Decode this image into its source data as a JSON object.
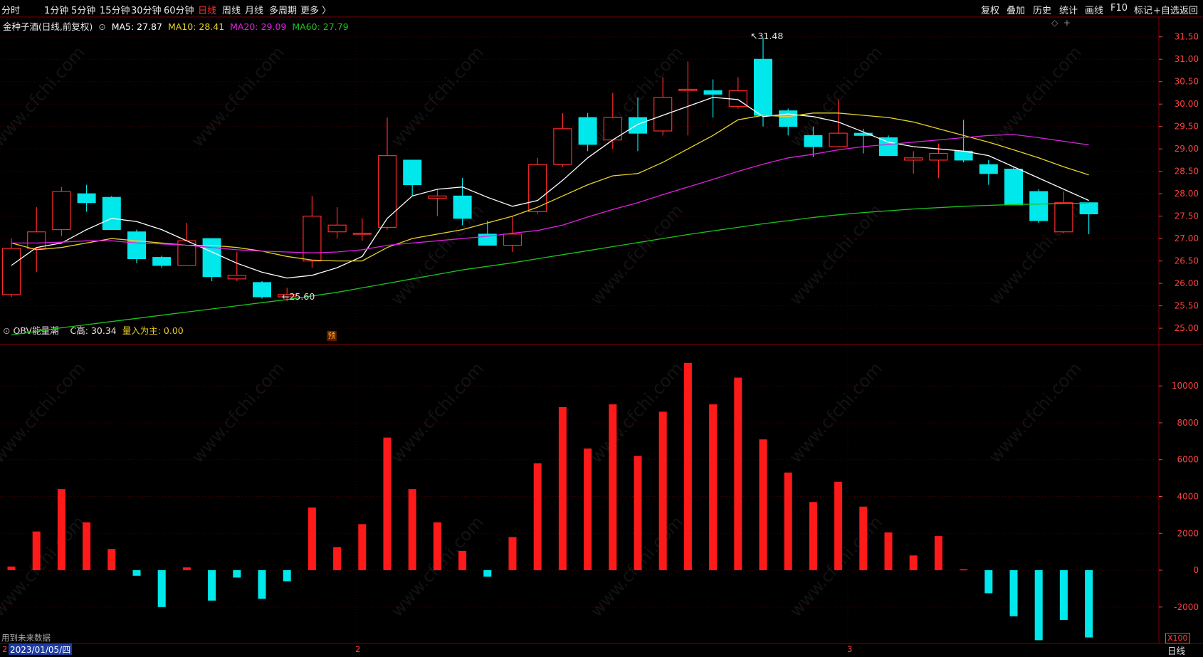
{
  "toolbar": {
    "periods": [
      "分时",
      "1分钟",
      "5分钟",
      "15分钟",
      "30分钟",
      "60分钟",
      "日线",
      "周线",
      "月线",
      "多周期",
      "更多 〉"
    ],
    "active_period": "日线",
    "tools": [
      "复权",
      "叠加",
      "历史",
      "统计",
      "画线",
      "F10",
      "标记",
      "+自选",
      "返回"
    ]
  },
  "main_legend": {
    "title": "金种子酒(日线,前复权)",
    "ma5": "MA5: 27.87",
    "ma10": "MA10: 28.41",
    "ma20": "MA20: 29.09",
    "ma60": "MA60: 27.79"
  },
  "sub_legend": {
    "title": "OBV能量潮",
    "c_high": "C高: 30.34",
    "volume": "量入为主: 0.00"
  },
  "annotations": {
    "high_label": "31.48",
    "low_label": "25.60",
    "forecast_badge": "预"
  },
  "bottom": {
    "future_data": "用到未来数据",
    "date": "2023/01/05/四",
    "month_2": "2",
    "month_3": "3",
    "period_label": "日线",
    "unit": "X100",
    "start_marker": "2"
  },
  "watermark": "www.cfchi.com",
  "colors": {
    "up": "#ff2a2a",
    "down": "#00e8ec",
    "ma5": "#ffffff",
    "ma10": "#e6d22d",
    "ma20": "#e020e0",
    "ma60": "#1ec21e",
    "grid": "#4a0000",
    "axis": "#ff4040"
  },
  "chart_data": [
    {
      "type": "candlestick",
      "title": "金种子酒(日线,前复权)",
      "ylim": [
        24.7,
        31.75
      ],
      "yticks": [
        25.0,
        25.5,
        26.0,
        26.5,
        27.0,
        27.5,
        28.0,
        28.5,
        29.0,
        29.5,
        30.0,
        30.5,
        31.0,
        31.5
      ],
      "candles": [
        {
          "o": 25.75,
          "h": 27.0,
          "l": 25.7,
          "c": 26.78
        },
        {
          "o": 26.78,
          "h": 27.7,
          "l": 26.25,
          "c": 27.15
        },
        {
          "o": 27.2,
          "h": 28.15,
          "l": 27.05,
          "c": 28.05
        },
        {
          "o": 28.0,
          "h": 28.2,
          "l": 27.6,
          "c": 27.8
        },
        {
          "o": 27.92,
          "h": 27.95,
          "l": 27.2,
          "c": 27.2
        },
        {
          "o": 27.15,
          "h": 27.2,
          "l": 26.45,
          "c": 26.55
        },
        {
          "o": 26.58,
          "h": 26.62,
          "l": 26.35,
          "c": 26.4
        },
        {
          "o": 26.4,
          "h": 27.35,
          "l": 26.4,
          "c": 26.95
        },
        {
          "o": 27.0,
          "h": 27.0,
          "l": 26.05,
          "c": 26.15
        },
        {
          "o": 26.1,
          "h": 26.7,
          "l": 26.05,
          "c": 26.18
        },
        {
          "o": 26.02,
          "h": 26.05,
          "l": 25.66,
          "c": 25.7
        },
        {
          "o": 25.7,
          "h": 25.9,
          "l": 25.6,
          "c": 25.75
        },
        {
          "o": 26.5,
          "h": 27.95,
          "l": 26.35,
          "c": 27.5
        },
        {
          "o": 27.15,
          "h": 27.7,
          "l": 27.0,
          "c": 27.3
        },
        {
          "o": 27.1,
          "h": 27.45,
          "l": 26.95,
          "c": 27.12
        },
        {
          "o": 27.25,
          "h": 29.7,
          "l": 27.2,
          "c": 28.85
        },
        {
          "o": 28.75,
          "h": 28.75,
          "l": 27.95,
          "c": 28.2
        },
        {
          "o": 27.9,
          "h": 28.1,
          "l": 27.5,
          "c": 27.95
        },
        {
          "o": 27.95,
          "h": 28.35,
          "l": 27.3,
          "c": 27.45
        },
        {
          "o": 27.1,
          "h": 27.4,
          "l": 26.85,
          "c": 26.85
        },
        {
          "o": 26.85,
          "h": 27.5,
          "l": 26.7,
          "c": 27.1
        },
        {
          "o": 27.6,
          "h": 28.8,
          "l": 27.55,
          "c": 28.65
        },
        {
          "o": 28.65,
          "h": 29.8,
          "l": 28.6,
          "c": 29.45
        },
        {
          "o": 29.7,
          "h": 29.8,
          "l": 28.95,
          "c": 29.1
        },
        {
          "o": 29.2,
          "h": 30.25,
          "l": 29.0,
          "c": 29.7
        },
        {
          "o": 29.7,
          "h": 30.15,
          "l": 28.95,
          "c": 29.35
        },
        {
          "o": 29.4,
          "h": 30.6,
          "l": 29.3,
          "c": 30.15
        },
        {
          "o": 30.3,
          "h": 30.95,
          "l": 29.3,
          "c": 30.33
        },
        {
          "o": 30.3,
          "h": 30.55,
          "l": 29.7,
          "c": 30.22
        },
        {
          "o": 29.95,
          "h": 30.6,
          "l": 29.9,
          "c": 30.3
        },
        {
          "o": 31.0,
          "h": 31.48,
          "l": 29.5,
          "c": 29.75
        },
        {
          "o": 29.85,
          "h": 29.9,
          "l": 29.3,
          "c": 29.5
        },
        {
          "o": 29.3,
          "h": 29.5,
          "l": 28.82,
          "c": 29.05
        },
        {
          "o": 29.05,
          "h": 30.1,
          "l": 29.05,
          "c": 29.35
        },
        {
          "o": 29.35,
          "h": 29.45,
          "l": 28.9,
          "c": 29.3
        },
        {
          "o": 29.25,
          "h": 29.3,
          "l": 28.85,
          "c": 28.85
        },
        {
          "o": 28.75,
          "h": 28.95,
          "l": 28.45,
          "c": 28.8
        },
        {
          "o": 28.75,
          "h": 29.12,
          "l": 28.35,
          "c": 28.9
        },
        {
          "o": 28.95,
          "h": 29.65,
          "l": 28.7,
          "c": 28.75
        },
        {
          "o": 28.65,
          "h": 28.75,
          "l": 28.2,
          "c": 28.45
        },
        {
          "o": 28.55,
          "h": 28.6,
          "l": 27.75,
          "c": 27.75
        },
        {
          "o": 28.05,
          "h": 28.1,
          "l": 27.35,
          "c": 27.4
        },
        {
          "o": 27.15,
          "h": 28.05,
          "l": 27.12,
          "c": 27.8
        },
        {
          "o": 27.8,
          "h": 27.8,
          "l": 27.1,
          "c": 27.55
        }
      ],
      "series": [
        {
          "name": "MA5",
          "values": [
            26.4,
            26.8,
            26.9,
            27.2,
            27.45,
            27.38,
            27.2,
            26.95,
            26.7,
            26.45,
            26.25,
            26.12,
            26.18,
            26.35,
            26.6,
            27.45,
            27.95,
            28.1,
            28.15,
            27.92,
            27.72,
            27.85,
            28.3,
            28.8,
            29.2,
            29.55,
            29.75,
            29.95,
            30.15,
            30.1,
            29.72,
            29.78,
            29.72,
            29.6,
            29.38,
            29.15,
            29.05,
            29.0,
            28.95,
            28.85,
            28.6,
            28.35,
            28.1,
            27.85
          ]
        },
        {
          "name": "MA10",
          "values": [
            26.9,
            26.75,
            26.8,
            26.9,
            27.0,
            26.95,
            26.9,
            26.85,
            26.85,
            26.8,
            26.72,
            26.6,
            26.52,
            26.5,
            26.5,
            26.8,
            27.0,
            27.1,
            27.2,
            27.35,
            27.5,
            27.7,
            27.95,
            28.2,
            28.4,
            28.45,
            28.7,
            29.0,
            29.3,
            29.65,
            29.75,
            29.72,
            29.8,
            29.8,
            29.75,
            29.7,
            29.6,
            29.45,
            29.3,
            29.15,
            28.98,
            28.8,
            28.6,
            28.42
          ]
        },
        {
          "name": "MA20",
          "values": [
            26.9,
            26.9,
            26.92,
            26.95,
            26.95,
            26.9,
            26.88,
            26.85,
            26.8,
            26.75,
            26.72,
            26.7,
            26.68,
            26.7,
            26.75,
            26.85,
            26.9,
            26.95,
            27.0,
            27.05,
            27.12,
            27.18,
            27.3,
            27.48,
            27.65,
            27.8,
            27.98,
            28.15,
            28.32,
            28.5,
            28.66,
            28.8,
            28.88,
            28.98,
            29.05,
            29.1,
            29.15,
            29.2,
            29.25,
            29.3,
            29.32,
            29.25,
            29.17,
            29.09
          ]
        },
        {
          "name": "MA60",
          "values": [
            24.85,
            24.93,
            25.01,
            25.08,
            25.15,
            25.22,
            25.29,
            25.36,
            25.43,
            25.5,
            25.57,
            25.64,
            25.72,
            25.8,
            25.9,
            26.0,
            26.1,
            26.2,
            26.3,
            26.38,
            26.46,
            26.55,
            26.64,
            26.73,
            26.82,
            26.91,
            27.0,
            27.09,
            27.17,
            27.25,
            27.33,
            27.4,
            27.47,
            27.53,
            27.58,
            27.62,
            27.66,
            27.69,
            27.72,
            27.74,
            27.76,
            27.77,
            27.78,
            27.79
          ]
        }
      ]
    },
    {
      "type": "bar",
      "title": "OBV能量潮",
      "ylim": [
        -3900,
        11900
      ],
      "yticks": [
        -2000,
        0,
        2000,
        4000,
        6000,
        8000,
        10000
      ],
      "unit": "X100",
      "values": [
        200,
        2100,
        4400,
        2600,
        1150,
        -300,
        -2000,
        150,
        -1650,
        -400,
        -1550,
        -600,
        3400,
        1250,
        2500,
        7200,
        4400,
        2600,
        1050,
        -350,
        1800,
        5800,
        8850,
        6600,
        9000,
        6200,
        8600,
        11250,
        9000,
        10450,
        7100,
        5300,
        3700,
        4800,
        3450,
        2050,
        800,
        1850,
        50,
        -1250,
        -2500,
        -3800,
        -2700,
        -3650
      ]
    }
  ]
}
